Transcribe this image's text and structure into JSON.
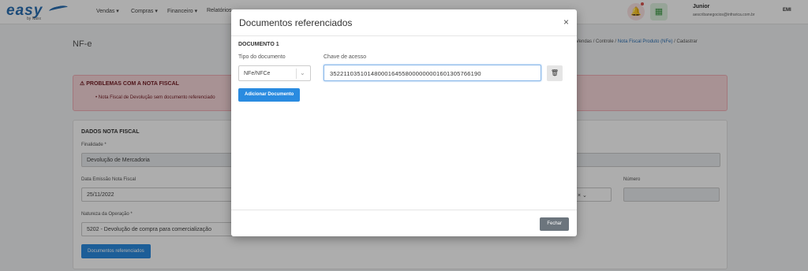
{
  "app": {
    "logo": "easy",
    "logo_sub": "by Naxx",
    "menu": [
      {
        "label": "Vendas ▾"
      },
      {
        "label": "Compras ▾"
      },
      {
        "label": "Financeiro ▾"
      },
      {
        "label": "Relatórios"
      }
    ],
    "user": {
      "name": "Junior",
      "email": "aescribanegocios@infrarica.com.br"
    },
    "brand_small": "EMI"
  },
  "page": {
    "title": "NF-e",
    "breadcrumb": {
      "part1": "Vendas",
      "part2": "Controle",
      "part3": "Nota Fiscal Produto (NFe)",
      "part4": "Cadastrar"
    }
  },
  "alert": {
    "title": "PROBLEMAS COM A NOTA FISCAL",
    "item": "Nota Fiscal de Devolução sem documento referenciado"
  },
  "card": {
    "title": "DADOS NOTA FISCAL",
    "finalidade_label": "Finalidade *",
    "finalidade_value": "Devolução de Mercadoria",
    "data_label": "Data Emissão Nota Fiscal",
    "data_value": "25/11/2022",
    "numero_label": "Número",
    "natureza_label": "Natureza da Operação *",
    "natureza_value": "5202 - Devolução de compra para comercialização",
    "docref_button": "Documentos referenciados"
  },
  "modal": {
    "title": "Documentos referenciados",
    "close": "×",
    "doc_title": "DOCUMENTO 1",
    "tipo_label": "Tipo do documento",
    "tipo_value": "NFe/NFCe",
    "chave_label": "Chave de acesso",
    "chave_value": "35221103510148000164558000000001601305766190",
    "add_button": "Adicionar Documento",
    "close_button": "Fechar"
  }
}
